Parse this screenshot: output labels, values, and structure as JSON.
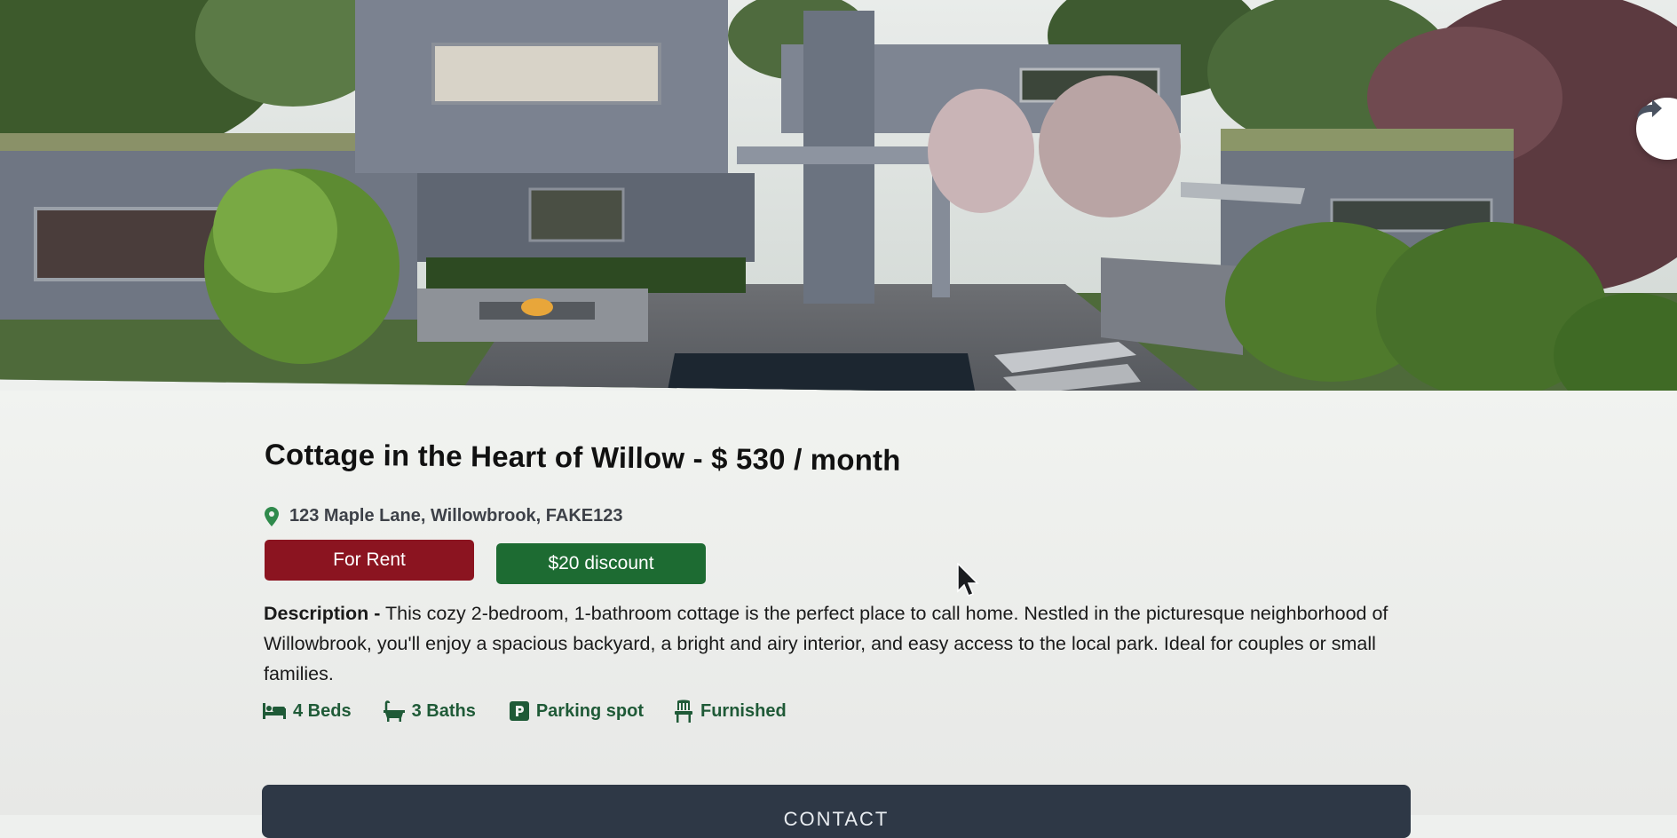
{
  "listing": {
    "title": "Cottage in the Heart of Willow - $ 530 / month",
    "address": "123 Maple Lane, Willowbrook, FAKE123",
    "badges": {
      "rent": "For Rent",
      "discount": "$20 discount"
    },
    "description_label": "Description -",
    "description_text": "This cozy 2-bedroom, 1-bathroom cottage is the perfect place to call home. Nestled in the picturesque neighborhood of Willowbrook, you'll enjoy a spacious backyard, a bright and airy interior, and easy access to the local park. Ideal for couples or small families.",
    "features": [
      {
        "icon": "bed-icon",
        "label": "4 Beds"
      },
      {
        "icon": "bath-icon",
        "label": "3 Baths"
      },
      {
        "icon": "parking-icon",
        "label": "Parking spot"
      },
      {
        "icon": "chair-icon",
        "label": "Furnished"
      }
    ],
    "contact_label": "CONTACT"
  },
  "colors": {
    "rent_badge": "#8b1420",
    "discount_badge": "#1d6b32",
    "feature_text": "#1f5a37",
    "contact_button": "#2e3846"
  },
  "icons": {
    "share": "share-arrow-icon",
    "location": "location-pin-icon"
  }
}
